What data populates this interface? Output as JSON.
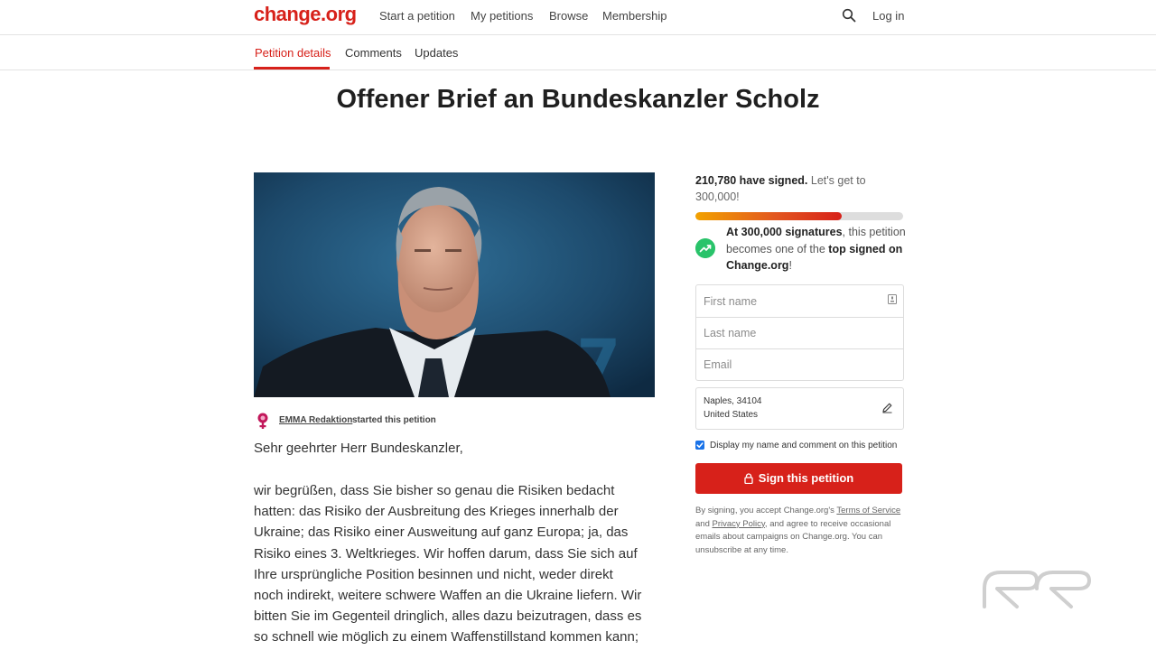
{
  "nav": {
    "logo": "change.org",
    "links": [
      "Start a petition",
      "My petitions",
      "Browse",
      "Membership"
    ],
    "login": "Log in"
  },
  "tabs": [
    "Petition details",
    "Comments",
    "Updates"
  ],
  "petition": {
    "title": "Offener Brief an Bundeskanzler Scholz",
    "starter_name": "EMMA Redaktion",
    "starter_text": "started this petition",
    "greeting": "Sehr geehrter Herr Bundeskanzler,",
    "body_lines": [
      "wir begrüßen, dass Sie bisher so genau die Risiken bedacht",
      "hatten: das Risiko der Ausbreitung des Krieges innerhalb der",
      "Ukraine; das Risiko einer Ausweitung auf ganz Europa; ja, das",
      "Risiko eines 3. Weltkrieges. Wir hoffen darum, dass Sie sich auf",
      "Ihre ursprüngliche Position besinnen und nicht, weder direkt",
      "noch indirekt, weitere schwere Waffen an die Ukraine liefern. Wir",
      "bitten Sie im Gegenteil dringlich, alles dazu beizutragen, dass es",
      "so schnell wie möglich zu einem Waffenstillstand kommen kann;"
    ]
  },
  "sidebar": {
    "signed_count": "210,780 have signed.",
    "goal_text": "Let's get to 300,000!",
    "progress_fraction": 0.7026,
    "top_bold1": "At 300,000 signatures",
    "top_text1": ", this petition becomes one of the ",
    "top_bold2": "top signed on Change.org",
    "top_text2": "!",
    "first_name_placeholder": "First name",
    "last_name_placeholder": "Last name",
    "email_placeholder": "Email",
    "location_line1": "Naples, 34104",
    "location_line2": "United States",
    "display_label": "Display my name and comment on this petition",
    "sign_label": "Sign this petition",
    "legal_text1": "By signing, you accept Change.org's ",
    "terms_link": "Terms of Service",
    "legal_text2": " and ",
    "privacy_link": "Privacy Policy",
    "legal_text3": ", and agree to receive occasional emails about campaigns on Change.org. You can unsubscribe at any time."
  },
  "colors": {
    "brand_red": "#d7211a",
    "trend_green": "#29c36a",
    "checkbox_blue": "#1a73e8"
  },
  "icons": [
    "search-icon",
    "trending-up-icon",
    "contact-card-icon",
    "pencil-icon",
    "lock-icon",
    "venus-symbol-icon",
    "watermark-logo"
  ]
}
